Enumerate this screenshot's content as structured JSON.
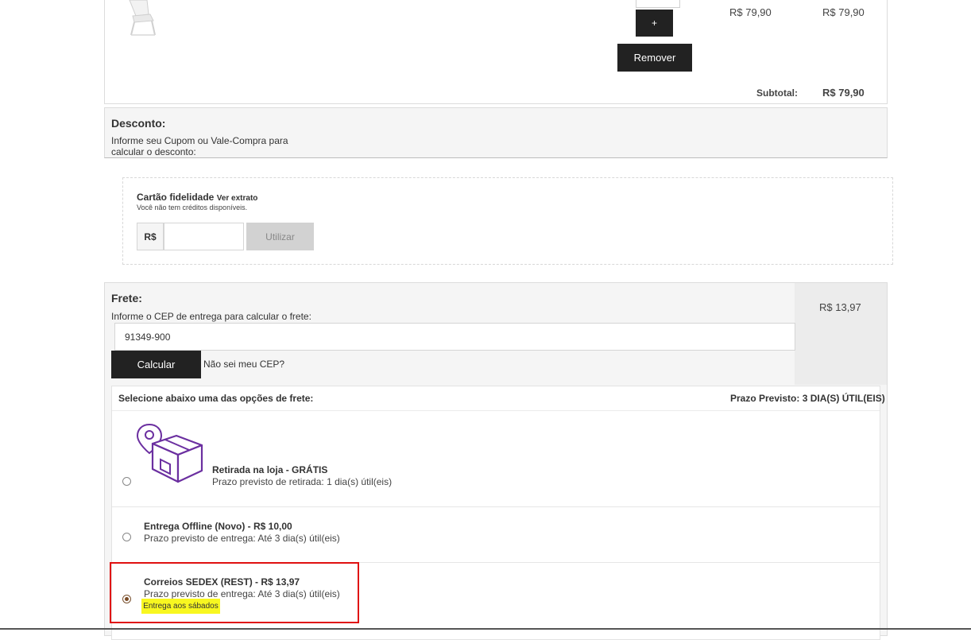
{
  "cart": {
    "unit_price": "R$ 79,90",
    "total_price": "R$ 79,90",
    "plus_label": "+",
    "remove_label": "Remover",
    "subtotal_label": "Subtotal:",
    "subtotal_value": "R$ 79,90"
  },
  "discount": {
    "title": "Desconto:",
    "instructions_line1": "Informe seu Cupom ou Vale-Compra para",
    "instructions_line2": "calcular o desconto:"
  },
  "loyalty": {
    "title": "Cartão fidelidade",
    "statement_link": "Ver extrato",
    "no_credits": "Você não tem créditos disponíveis.",
    "currency_prefix": "R$",
    "input_value": "",
    "use_label": "Utilizar"
  },
  "freight": {
    "title": "Frete:",
    "instructions": "Informe o CEP de entrega para calcular o frete:",
    "cep_value": "91349-900",
    "calculate_label": "Calcular",
    "unknown_cep_link": "Não sei meu CEP?",
    "amount": "R$ 13,97",
    "select_label": "Selecione abaixo uma das opções de frete:",
    "estimated_label": "Prazo Previsto: 3 DIA(S) ÚTIL(EIS)",
    "options": [
      {
        "title": "Retirada na loja - GRÁTIS",
        "subtitle": "Prazo previsto de retirada: 1 dia(s) útil(eis)",
        "selected": false,
        "icon": "store-pickup-box-icon"
      },
      {
        "title": "Entrega Offline (Novo) - R$ 10,00",
        "subtitle": "Prazo previsto de entrega: Até 3 dia(s) útil(eis)",
        "selected": false
      },
      {
        "title": "Correios SEDEX (REST) - R$ 13,97",
        "subtitle": "Prazo previsto de entrega: Até 3 dia(s) útil(eis)",
        "badge": "Entrega aos sábados",
        "selected": true
      }
    ]
  },
  "colors": {
    "button_dark": "#222222",
    "highlight_border": "#e01010",
    "badge_yellow": "#f8f720",
    "icon_purple": "#6b2fa0"
  }
}
